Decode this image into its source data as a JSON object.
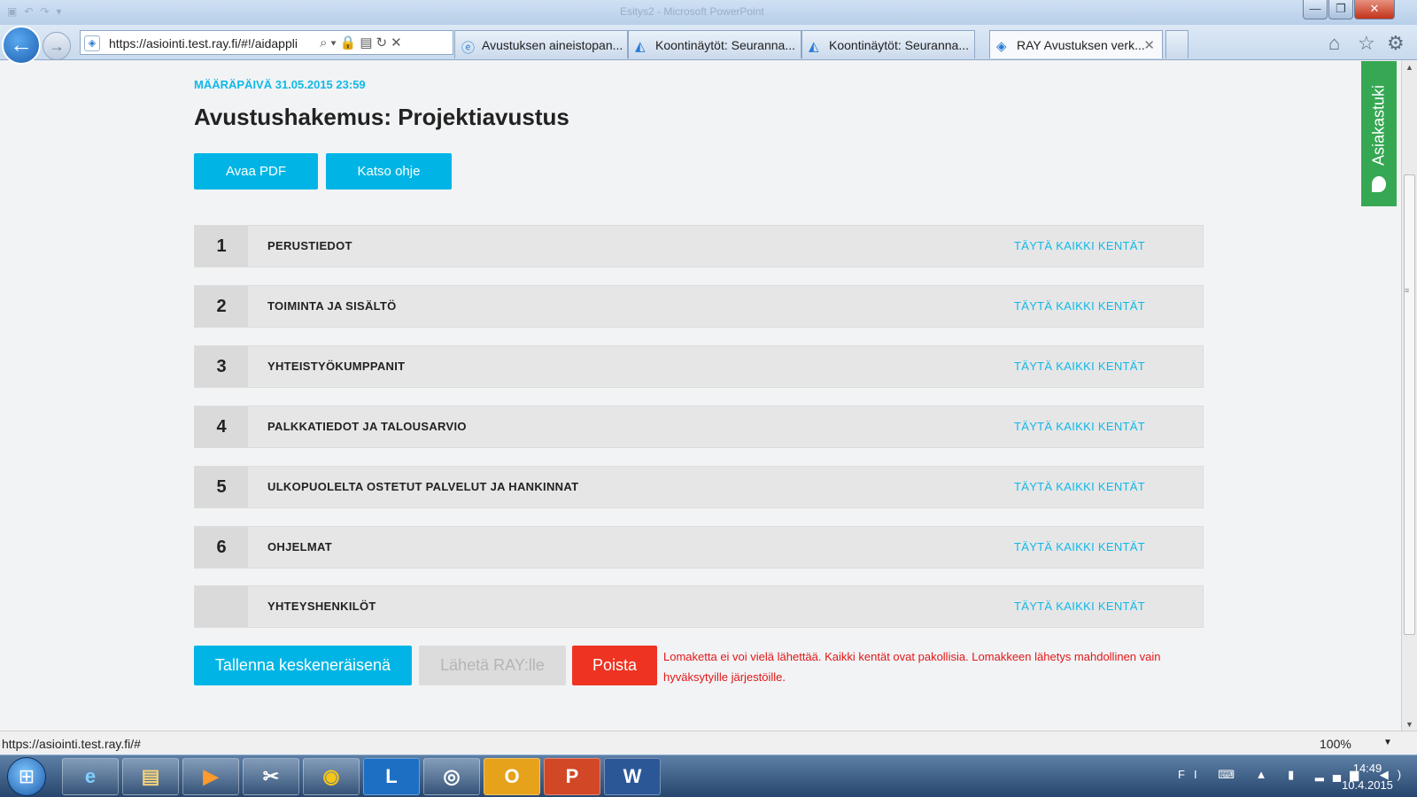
{
  "window": {
    "title": "Esitys2 - Microsoft PowerPoint"
  },
  "browser": {
    "url": "https://asiointi.test.ray.fi/#!/aidappli",
    "tabs": [
      {
        "label": "Avustuksen aineistopan..."
      },
      {
        "label": "Koontinäytöt: Seuranna..."
      },
      {
        "label": "Koontinäytöt: Seuranna..."
      },
      {
        "label": "RAY Avustuksen verk..."
      }
    ]
  },
  "page": {
    "deadline": "MÄÄRÄPÄIVÄ 31.05.2015 23:59",
    "title": "Avustushakemus: Projektiavustus",
    "open_pdf": "Avaa PDF",
    "view_help": "Katso ohje",
    "sections": [
      {
        "num": "1",
        "name": "PERUSTIEDOT",
        "status": "TÄYTÄ KAIKKI KENTÄT"
      },
      {
        "num": "2",
        "name": "TOIMINTA JA SISÄLTÖ",
        "status": "TÄYTÄ KAIKKI KENTÄT"
      },
      {
        "num": "3",
        "name": "YHTEISTYÖKUMPPANIT",
        "status": "TÄYTÄ KAIKKI KENTÄT"
      },
      {
        "num": "4",
        "name": "PALKKATIEDOT JA TALOUSARVIO",
        "status": "TÄYTÄ KAIKKI KENTÄT"
      },
      {
        "num": "5",
        "name": "ULKOPUOLELTA OSTETUT PALVELUT JA HANKINNAT",
        "status": "TÄYTÄ KAIKKI KENTÄT"
      },
      {
        "num": "6",
        "name": "OHJELMAT",
        "status": "TÄYTÄ KAIKKI KENTÄT"
      },
      {
        "num": "",
        "name": "YHTEYSHENKILÖT",
        "status": "TÄYTÄ KAIKKI KENTÄT"
      }
    ],
    "save_draft": "Tallenna keskeneräisenä",
    "send": "Lähetä RAY:lle",
    "delete": "Poista",
    "error": "Lomaketta ei voi vielä lähettää. Kaikki kentät ovat pakollisia. Lomakkeen lähetys mahdollinen vain hyväksytyille järjestöille.",
    "support_tab": "Asiakastuki"
  },
  "statusbar": {
    "url": "https://asiointi.test.ray.fi/#",
    "zoom": "100%"
  },
  "taskbar": {
    "language": "FI",
    "time": "14:49",
    "date": "10.4.2015"
  },
  "colors": {
    "accent": "#00b5e5",
    "danger": "#ee3322",
    "support": "#36a853"
  }
}
